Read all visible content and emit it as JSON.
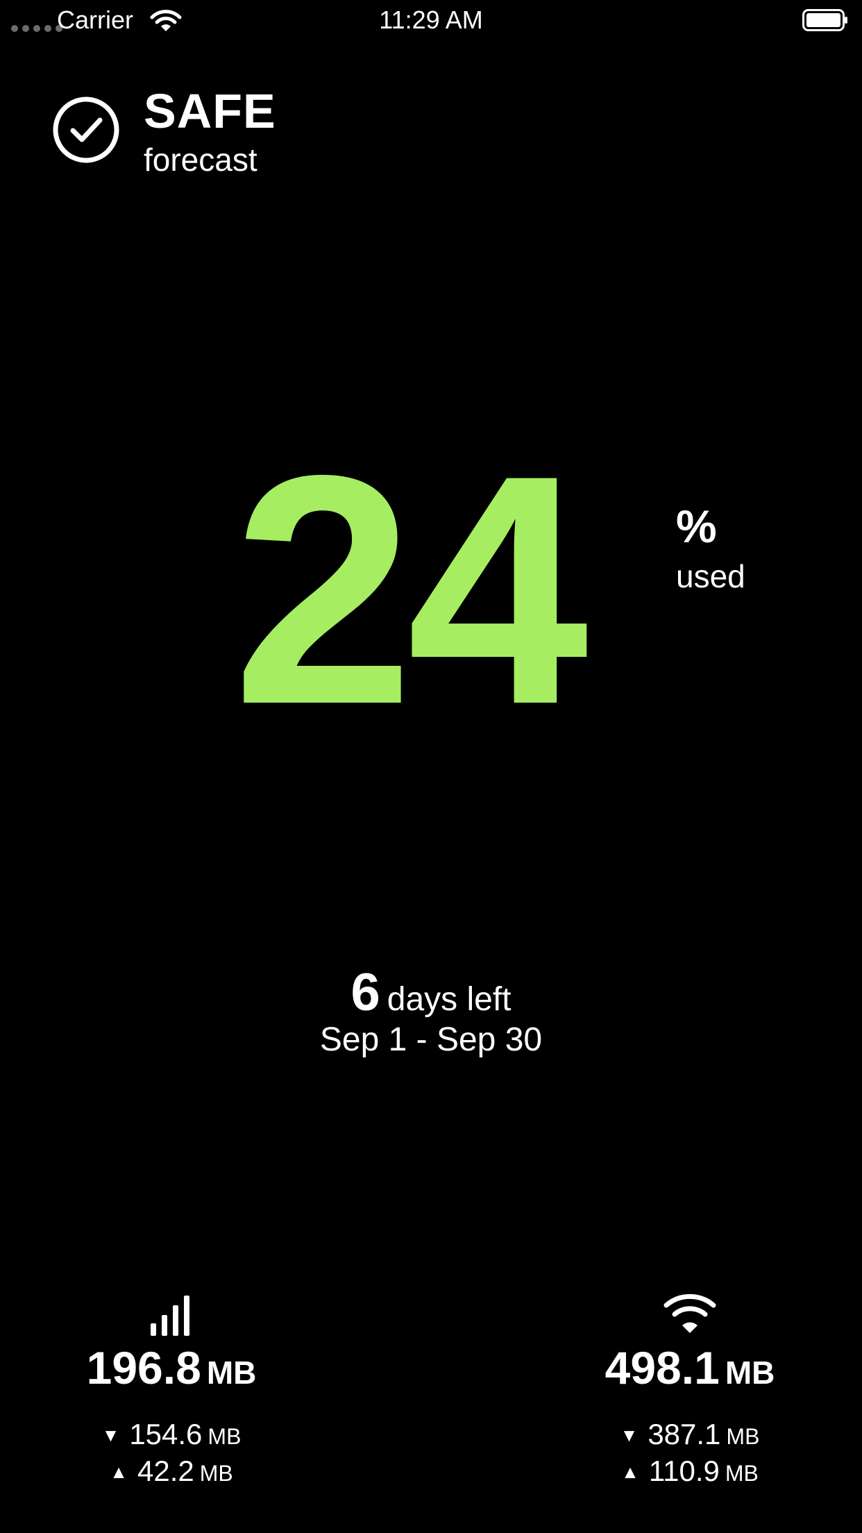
{
  "status_bar": {
    "carrier": "Carrier",
    "time": "11:29 AM"
  },
  "forecast": {
    "status": "SAFE",
    "label": "forecast",
    "icon": "checkmark-circle-icon"
  },
  "usage": {
    "value": "24",
    "unit": "%",
    "label": "used",
    "color": "#a6ed61"
  },
  "days": {
    "count": "6",
    "label": "days left",
    "period": "Sep 1 - Sep 30"
  },
  "cellular": {
    "icon": "cellular-signal-icon",
    "total": "196.8",
    "total_unit": "MB",
    "download": "154.6",
    "download_unit": "MB",
    "upload": "42.2",
    "upload_unit": "MB",
    "download_arrow": "▼",
    "upload_arrow": "▲"
  },
  "wifi": {
    "icon": "wifi-icon",
    "total": "498.1",
    "total_unit": "MB",
    "download": "387.1",
    "download_unit": "MB",
    "upload": "110.9",
    "upload_unit": "MB",
    "download_arrow": "▼",
    "upload_arrow": "▲"
  }
}
